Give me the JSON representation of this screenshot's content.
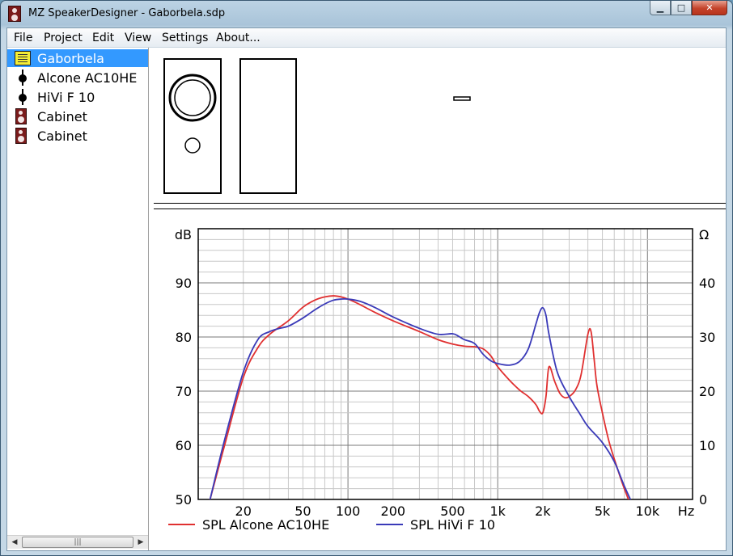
{
  "window": {
    "title": "MZ SpeakerDesigner - Gaborbela.sdp",
    "buttons": {
      "minimize": "▁",
      "maximize": "□",
      "close": "✕"
    }
  },
  "menu": [
    "File",
    "Project",
    "Edit",
    "View",
    "Settings",
    "About..."
  ],
  "tree": {
    "items": [
      {
        "label": "Gaborbela",
        "icon": "project-icon",
        "selected": true
      },
      {
        "label": "Alcone AC10HE",
        "icon": "driver-icon"
      },
      {
        "label": "HiVi F 10",
        "icon": "driver-icon"
      },
      {
        "label": "Cabinet",
        "icon": "cabinet-icon"
      },
      {
        "label": "Cabinet",
        "icon": "cabinet-icon"
      }
    ],
    "scroll_thumb_glyph": "|||"
  },
  "chart_data": {
    "type": "line",
    "xscale": "log",
    "xlim": [
      10,
      20000
    ],
    "ylim": [
      50,
      100
    ],
    "y2lim": [
      0,
      50
    ],
    "ylabel": "dB",
    "y2label": "Ω",
    "xunit": "Hz",
    "grid": true,
    "x_ticks": [
      {
        "value": 20,
        "label": "20"
      },
      {
        "value": 50,
        "label": "50"
      },
      {
        "value": 100,
        "label": "100"
      },
      {
        "value": 200,
        "label": "200"
      },
      {
        "value": 500,
        "label": "500"
      },
      {
        "value": 1000,
        "label": "1k"
      },
      {
        "value": 2000,
        "label": "2k"
      },
      {
        "value": 5000,
        "label": "5k"
      },
      {
        "value": 10000,
        "label": "10k"
      }
    ],
    "y_ticks": [
      50,
      60,
      70,
      80,
      90
    ],
    "y2_ticks": [
      0,
      10,
      20,
      30,
      40
    ],
    "legend_position": "bottom",
    "series": [
      {
        "name": "SPL Alcone AC10HE",
        "color": "#e03030",
        "x": [
          12,
          15,
          20,
          25,
          30,
          40,
          50,
          60,
          70,
          80,
          90,
          100,
          120,
          150,
          200,
          300,
          400,
          500,
          600,
          700,
          800,
          900,
          1000,
          1200,
          1400,
          1600,
          1800,
          1900,
          2000,
          2100,
          2200,
          2400,
          2600,
          2800,
          3000,
          3300,
          3600,
          4000,
          4200,
          4400,
          4600,
          5000,
          5500,
          6000,
          7000,
          8000
        ],
        "y": [
          50,
          60,
          72.5,
          78,
          80.5,
          83,
          85.5,
          86.8,
          87.4,
          87.6,
          87.4,
          87,
          86,
          84.6,
          83,
          81,
          79.5,
          78.7,
          78.3,
          78.2,
          77.8,
          76.5,
          74.5,
          72,
          70.2,
          69,
          67.5,
          66.3,
          66,
          69,
          74.5,
          71.8,
          69.6,
          68.8,
          69,
          70.2,
          73,
          80.5,
          81,
          76,
          71,
          66,
          61,
          57.5,
          52,
          48
        ]
      },
      {
        "name": "SPL HiVi F 10",
        "color": "#3a3ab8",
        "x": [
          12,
          15,
          20,
          25,
          30,
          35,
          40,
          50,
          60,
          70,
          80,
          90,
          100,
          120,
          150,
          200,
          300,
          400,
          500,
          550,
          600,
          700,
          800,
          900,
          1000,
          1200,
          1400,
          1600,
          1800,
          1900,
          2000,
          2100,
          2200,
          2500,
          3000,
          3500,
          4000,
          5000,
          6000,
          7000,
          8000
        ],
        "y": [
          50,
          61,
          73.5,
          79.5,
          81,
          81.6,
          82,
          83.5,
          85,
          86.1,
          86.8,
          87,
          87,
          86.6,
          85.5,
          83.7,
          81.6,
          80.5,
          80.6,
          80.1,
          79.5,
          78.8,
          76.8,
          75.6,
          75.1,
          74.8,
          75.5,
          77.8,
          82.4,
          84.5,
          85.4,
          84,
          80.5,
          73.5,
          69,
          66,
          63.5,
          60.5,
          57,
          52.5,
          49
        ]
      }
    ]
  }
}
